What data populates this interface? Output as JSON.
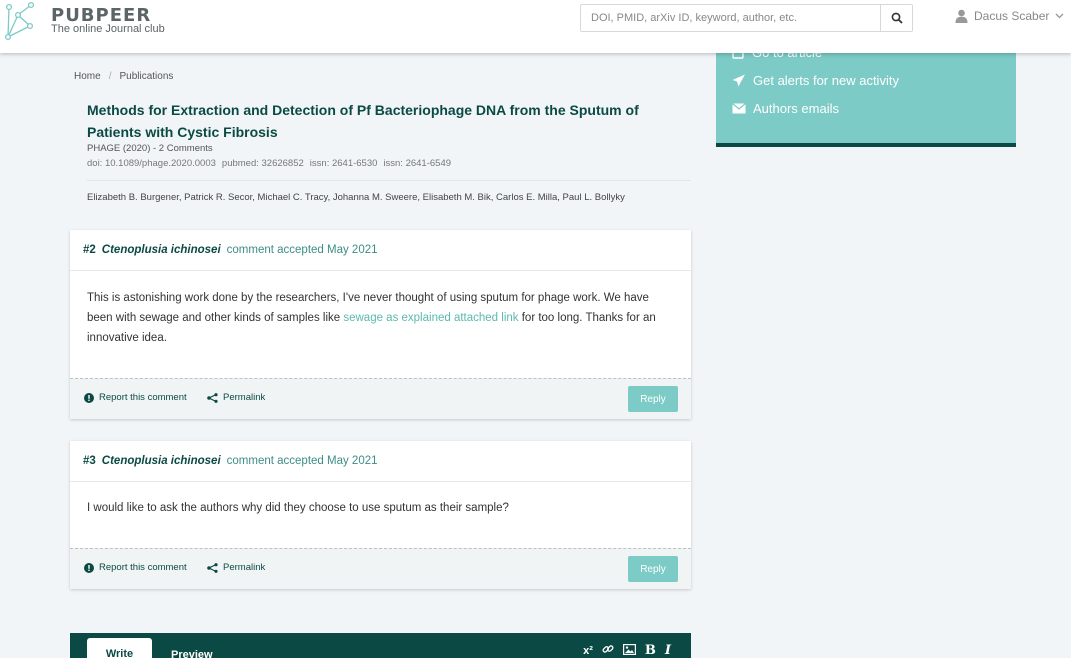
{
  "header": {
    "brand": "PUBPEER",
    "tagline": "The online Journal club",
    "search_placeholder": "DOI, PMID, arXiv ID, keyword, author, etc.",
    "user_name": "Dacus Scaber"
  },
  "sidebar": {
    "items": [
      {
        "label": "Go to article",
        "icon": "external-link-icon"
      },
      {
        "label": "Get alerts for new activity",
        "icon": "paper-plane-icon"
      },
      {
        "label": "Authors emails",
        "icon": "envelope-icon"
      }
    ]
  },
  "breadcrumb": {
    "home": "Home",
    "separator": "/",
    "current": "Publications"
  },
  "publication": {
    "title": "Methods for Extraction and Detection of Pf Bacteriophage DNA from the Sputum of Patients with Cystic Fibrosis",
    "journal_line": "PHAGE (2020) - 2 Comments",
    "ids": [
      "doi: 10.1089/phage.2020.0003",
      "pubmed: 32626852",
      "issn: 2641-6530",
      "issn: 2641-6549"
    ],
    "authors": "Elizabeth B. Burgener, Patrick R. Secor, Michael C. Tracy, Johanna M. Sweere, Elisabeth M. Bik, Carlos E. Milla, Paul L. Bollyky"
  },
  "comments": [
    {
      "number": "#2",
      "author": "Ctenoplusia ichinosei",
      "status": "comment accepted May 2021",
      "body_before": "This is astonishing work done by the researchers, I've never thought of using sputum for phage work. We have been with sewage and other kinds of samples like ",
      "body_link": "sewage as explained attached link",
      "body_after": " for too long. Thanks for an innovative idea.",
      "report_label": "Report this comment",
      "permalink_label": "Permalink",
      "reply_label": "Reply"
    },
    {
      "number": "#3",
      "author": "Ctenoplusia ichinosei",
      "status": "comment accepted May 2021",
      "body_before": "I would like to ask the authors why did they choose to use sputum as their sample?",
      "body_link": "",
      "body_after": "",
      "report_label": "Report this comment",
      "permalink_label": "Permalink",
      "reply_label": "Reply"
    }
  ],
  "editor": {
    "tab_write": "Write",
    "tab_preview": "Preview",
    "tools": {
      "superscript": "x²",
      "bold": "B",
      "italic": "I"
    }
  },
  "colors": {
    "brand_dark": "#0b4a44",
    "accent": "#7ccbc6",
    "link": "#5bb9ae",
    "background": "#f1f5f8"
  }
}
